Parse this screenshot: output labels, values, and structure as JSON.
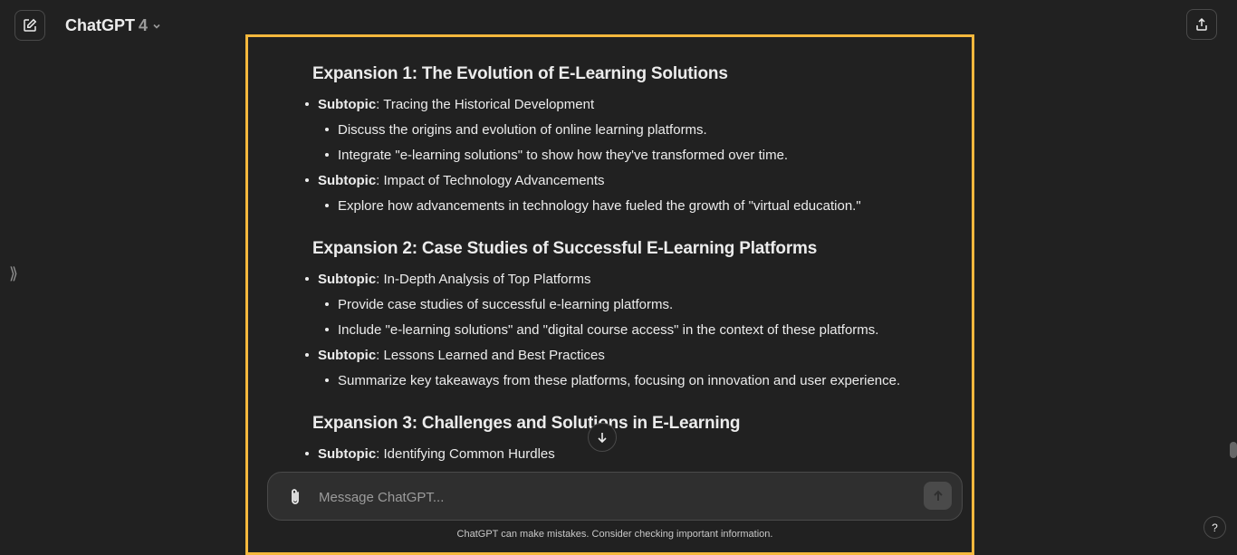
{
  "header": {
    "model_name": "ChatGPT",
    "model_version": "4",
    "new_chat_icon": "edit-icon",
    "share_icon": "share-icon",
    "dropdown_icon": "chevron-down-icon"
  },
  "sidebar_toggle": {
    "icon": "chevron-right-icon",
    "label": "⟫"
  },
  "content": {
    "sections": [
      {
        "title": "Expansion 1: The Evolution of E-Learning Solutions",
        "subtopics": [
          {
            "label": "Subtopic",
            "text": ": Tracing the Historical Development",
            "points": [
              "Discuss the origins and evolution of online learning platforms.",
              "Integrate \"e-learning solutions\" to show how they've transformed over time."
            ]
          },
          {
            "label": "Subtopic",
            "text": ": Impact of Technology Advancements",
            "points": [
              "Explore how advancements in technology have fueled the growth of \"virtual education.\""
            ]
          }
        ]
      },
      {
        "title": "Expansion 2: Case Studies of Successful E-Learning Platforms",
        "subtopics": [
          {
            "label": "Subtopic",
            "text": ": In-Depth Analysis of Top Platforms",
            "points": [
              "Provide case studies of successful e-learning platforms.",
              "Include \"e-learning solutions\" and \"digital course access\" in the context of these platforms."
            ]
          },
          {
            "label": "Subtopic",
            "text": ": Lessons Learned and Best Practices",
            "points": [
              "Summarize key takeaways from these platforms, focusing on innovation and user experience."
            ]
          }
        ]
      },
      {
        "title": "Expansion 3: Challenges and Solutions in E-Learning",
        "subtopics": [
          {
            "label": "Subtopic",
            "text": ": Identifying Common Hurdles",
            "points": []
          }
        ]
      }
    ]
  },
  "composer": {
    "placeholder": "Message ChatGPT...",
    "attach_icon": "paperclip-icon",
    "send_icon": "arrow-up-icon"
  },
  "scroll_down_icon": "arrow-down-icon",
  "disclaimer": "ChatGPT can make mistakes. Consider checking important information.",
  "help_label": "?",
  "colors": {
    "background": "#212121",
    "highlight_border": "#f5b83d",
    "composer": "#2f2f2f"
  }
}
